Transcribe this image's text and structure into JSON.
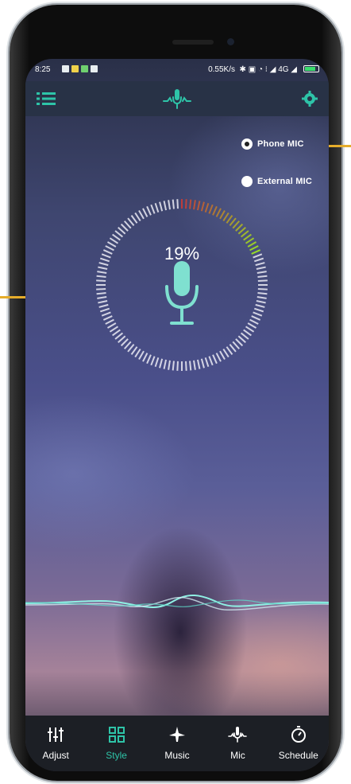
{
  "status_bar": {
    "time": "8:25",
    "network_text": "0.55K/s",
    "signal_text": "4G"
  },
  "app_bar": {
    "menu_icon": "list-menu-icon",
    "logo_icon": "microphone-wave-icon",
    "settings_icon": "gear-icon"
  },
  "mic_source": {
    "options": [
      {
        "label": "Phone MIC",
        "selected": true
      },
      {
        "label": "External MIC",
        "selected": false
      }
    ]
  },
  "level_meter": {
    "percent_text": "19%",
    "level": 0.19,
    "mic_icon": "microphone-icon"
  },
  "bottom_nav": {
    "active": "Style",
    "items": [
      {
        "label": "Adjust",
        "icon": "sliders-icon"
      },
      {
        "label": "Style",
        "icon": "grid-icon"
      },
      {
        "label": "Music",
        "icon": "plane-music-icon"
      },
      {
        "label": "Mic",
        "icon": "microphone-wave-icon"
      },
      {
        "label": "Schedule",
        "icon": "timer-icon"
      }
    ]
  },
  "colors": {
    "accent": "#2ec4a8",
    "app_bar": "#283246",
    "nav_bar": "#1c1f25",
    "callout": "#e6ad2b"
  }
}
